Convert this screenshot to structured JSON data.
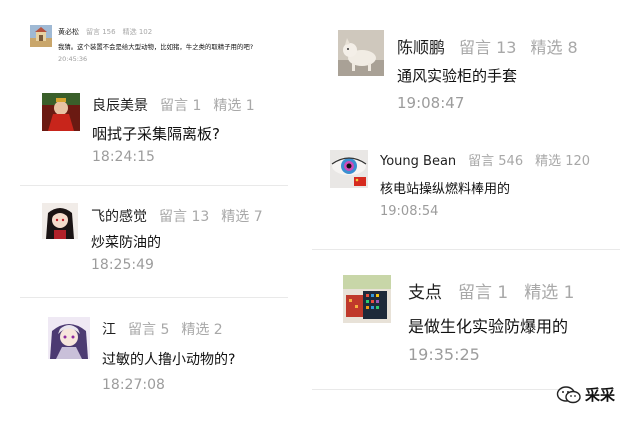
{
  "comments": [
    {
      "name": "黄必松",
      "comments_label": "留言 156",
      "picks_label": "精选 102",
      "text": "我猜。这个装置不会是给大型动物，比如猪，牛之类的取精子用的吧?",
      "time": "20:45:36",
      "avatar_icon": "building-photo-icon"
    },
    {
      "name": "良辰美景",
      "comments_label": "留言 1",
      "picks_label": "精选 1",
      "text": "咽拭子采集隔离板?",
      "time": "18:24:15",
      "avatar_icon": "red-costume-photo-icon"
    },
    {
      "name": "飞的感觉",
      "comments_label": "留言 13",
      "picks_label": "精选 7",
      "text": "炒菜防油的",
      "time": "18:25:49",
      "avatar_icon": "anime-girl-icon"
    },
    {
      "name": "江",
      "comments_label": "留言 5",
      "picks_label": "精选 2",
      "text": "过敏的人撸小动物的?",
      "time": "18:27:08",
      "avatar_icon": "anime-character-icon"
    },
    {
      "name": "陈顺鹏",
      "comments_label": "留言 13",
      "picks_label": "精选 8",
      "text": "通风实验柜的手套",
      "time": "19:08:47",
      "avatar_icon": "dog-photo-icon"
    },
    {
      "name": "Young Bean",
      "comments_label": "留言 546",
      "picks_label": "精选 120",
      "text": "核电站操纵燃料棒用的",
      "time": "19:08:54",
      "avatar_icon": "eye-photo-icon"
    },
    {
      "name": "支点",
      "comments_label": "留言 1",
      "picks_label": "精选 1",
      "text": "是做生化实验防爆用的",
      "time": "19:35:25",
      "avatar_icon": "pixel-speaker-icon"
    }
  ],
  "watermark": {
    "label": "采采",
    "icon": "wechat-official-account-icon"
  },
  "colors": {
    "name": "#1f1f1f",
    "stat": "#a8a8a8",
    "time": "#9c9c9c",
    "divider": "#e9e9e9"
  }
}
